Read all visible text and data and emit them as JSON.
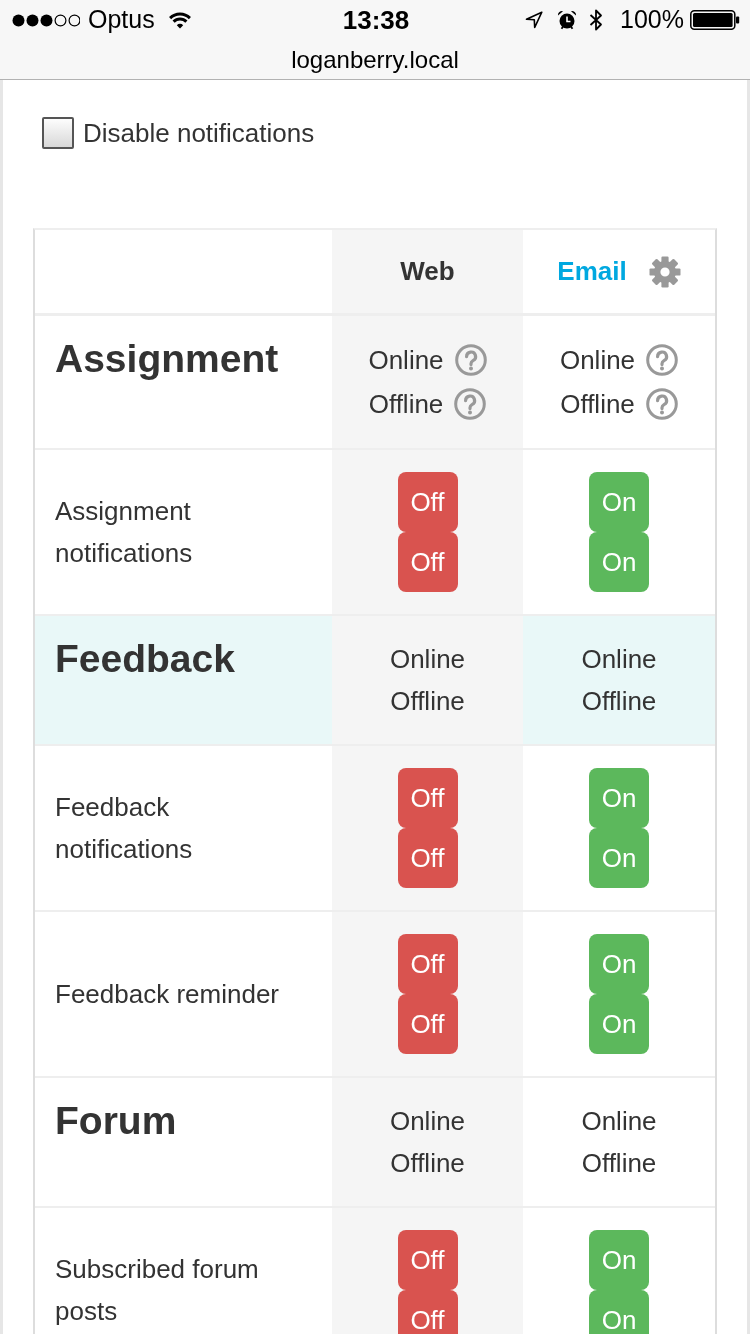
{
  "status_bar": {
    "carrier": "Optus",
    "time": "13:38",
    "battery": "100%"
  },
  "address_bar": {
    "url": "loganberry.local"
  },
  "disable_notifications": {
    "label": "Disable notifications",
    "checked": false
  },
  "table": {
    "columns": [
      {
        "label": "Web",
        "kind": "plain",
        "settings": false
      },
      {
        "label": "Email",
        "kind": "link",
        "settings": true
      }
    ],
    "sections": [
      {
        "title": "Assignment",
        "highlighted": false,
        "cells": [
          {
            "states": [
              {
                "label": "Online",
                "help": true
              },
              {
                "label": "Offline",
                "help": true
              }
            ]
          },
          {
            "states": [
              {
                "label": "Online",
                "help": true
              },
              {
                "label": "Offline",
                "help": true
              }
            ]
          }
        ],
        "items": [
          {
            "name": "Assignment notifications",
            "cells": [
              {
                "toggles": [
                  {
                    "label": "Off",
                    "on": false
                  },
                  {
                    "label": "Off",
                    "on": false
                  }
                ]
              },
              {
                "toggles": [
                  {
                    "label": "On",
                    "on": true
                  },
                  {
                    "label": "On",
                    "on": true
                  }
                ]
              }
            ]
          }
        ]
      },
      {
        "title": "Feedback",
        "highlighted": true,
        "cells": [
          {
            "states": [
              {
                "label": "Online",
                "help": false
              },
              {
                "label": "Offline",
                "help": false
              }
            ]
          },
          {
            "states": [
              {
                "label": "Online",
                "help": false
              },
              {
                "label": "Offline",
                "help": false
              }
            ]
          }
        ],
        "items": [
          {
            "name": "Feedback notifications",
            "cells": [
              {
                "toggles": [
                  {
                    "label": "Off",
                    "on": false
                  },
                  {
                    "label": "Off",
                    "on": false
                  }
                ]
              },
              {
                "toggles": [
                  {
                    "label": "On",
                    "on": true
                  },
                  {
                    "label": "On",
                    "on": true
                  }
                ]
              }
            ]
          },
          {
            "name": "Feedback reminder",
            "cells": [
              {
                "toggles": [
                  {
                    "label": "Off",
                    "on": false
                  },
                  {
                    "label": "Off",
                    "on": false
                  }
                ]
              },
              {
                "toggles": [
                  {
                    "label": "On",
                    "on": true
                  },
                  {
                    "label": "On",
                    "on": true
                  }
                ]
              }
            ]
          }
        ]
      },
      {
        "title": "Forum",
        "highlighted": false,
        "cells": [
          {
            "states": [
              {
                "label": "Online",
                "help": false
              },
              {
                "label": "Offline",
                "help": false
              }
            ]
          },
          {
            "states": [
              {
                "label": "Online",
                "help": false
              },
              {
                "label": "Offline",
                "help": false
              }
            ]
          }
        ],
        "items": [
          {
            "name": "Subscribed forum posts",
            "cells": [
              {
                "toggles": [
                  {
                    "label": "Off",
                    "on": false
                  },
                  {
                    "label": "Off",
                    "on": false
                  }
                ]
              },
              {
                "toggles": [
                  {
                    "label": "On",
                    "on": true
                  },
                  {
                    "label": "On",
                    "on": true
                  }
                ]
              }
            ]
          }
        ]
      }
    ]
  }
}
